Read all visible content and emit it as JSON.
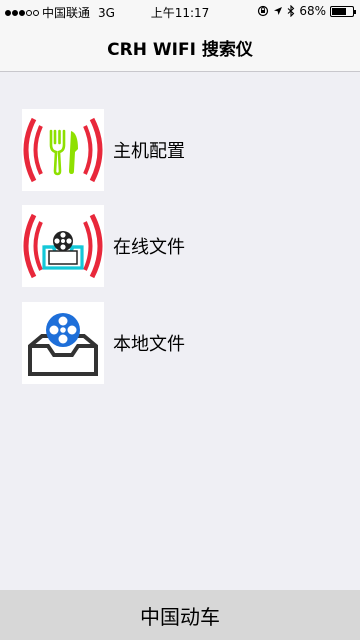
{
  "status": {
    "carrier": "中国联通",
    "network": "3G",
    "time": "上午11:17",
    "battery": "68%",
    "battery_level": 0.68,
    "signal_full": 3,
    "signal_total": 5
  },
  "nav": {
    "title": "CRH WIFI 搜索仪"
  },
  "menu": [
    {
      "label": "主机配置",
      "icon": "host-config-icon"
    },
    {
      "label": "在线文件",
      "icon": "online-files-icon"
    },
    {
      "label": "本地文件",
      "icon": "local-files-icon"
    }
  ],
  "footer": {
    "label": "中国动车"
  },
  "colors": {
    "red": "#e8283b",
    "green": "#8ee000",
    "cyan": "#14c8d8",
    "blue": "#1e6fd9"
  }
}
